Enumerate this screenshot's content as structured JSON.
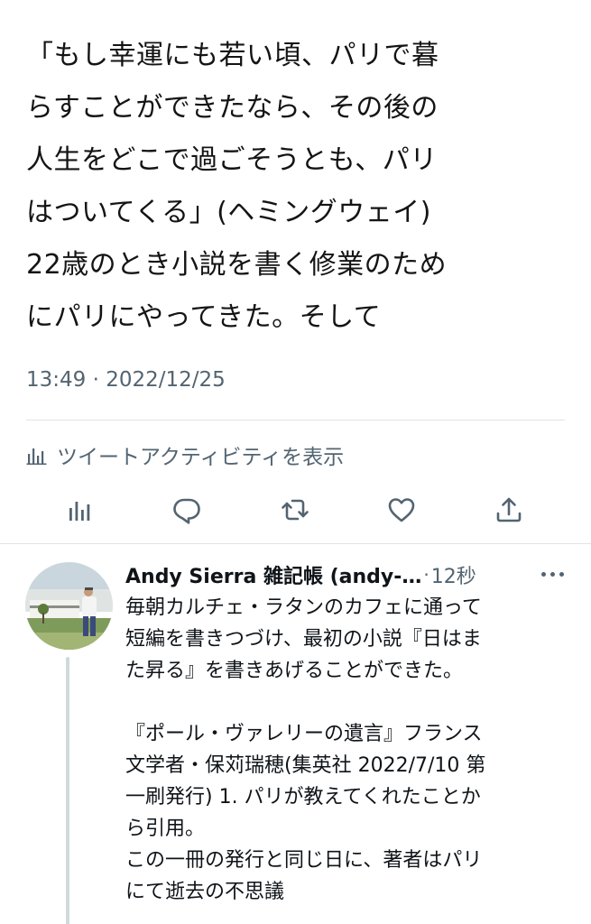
{
  "tweet": {
    "text": "「もし幸運にも若い頃、パリで暮\nらすことができたなら、その後の\n人生をどこで過ごそうとも、パリ\nはついてくる」(ヘミングウェイ)\n22歳のとき小説を書く修業のため\nにパリにやってきた。そして",
    "timestamp": "13:49 · 2022/12/25",
    "activity_label": "ツイートアクティビティを表示"
  },
  "actions": {
    "icons": [
      "analytics-icon",
      "reply-icon",
      "retweet-icon",
      "like-icon",
      "share-icon"
    ]
  },
  "reply": {
    "name": "Andy Sierra 雑記帳 (andy-…",
    "dot": "·",
    "time": "12秒",
    "text": "毎朝カルチェ・ラタンのカフェに通って\n短編を書きつづけ、最初の小説『日はま\nた昇る』を書きあげることができた。\n\n『ポール・ヴァレリーの遺言』フランス\n文学者・保苅瑞穂(集英社 2022/7/10 第\n一刷発行) 1. パリが教えてくれたことか\nら引用。\nこの一冊の発行と同じ日に、著者はパリ\nにて逝去の不思議"
  },
  "colors": {
    "text": "#0f1419",
    "secondary": "#536471",
    "divider": "#dfe3e7",
    "thread": "#cfd9de"
  }
}
